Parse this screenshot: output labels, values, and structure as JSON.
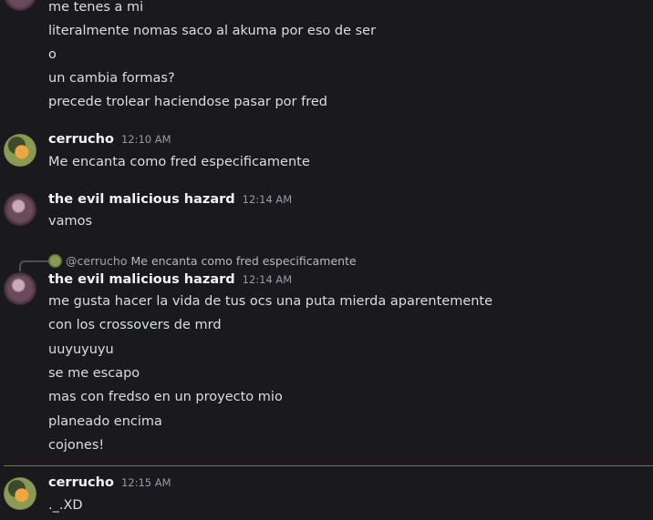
{
  "top_group": {
    "lines": [
      "me tenes a mi",
      "literalmente nomas saco al akuma por eso de ser",
      "o",
      "un cambia formas?",
      "precede trolear haciendose pasar por fred"
    ]
  },
  "messages": [
    {
      "username": "cerrucho",
      "timestamp": "12:10 AM",
      "lines": [
        "Me encanta como fred especificamente"
      ]
    },
    {
      "username": "the evil malicious hazard",
      "timestamp": "12:14 AM",
      "lines": [
        "vamos"
      ]
    },
    {
      "reply": {
        "username": "@cerrucho",
        "text": "Me encanta como fred especificamente"
      },
      "username": "the evil malicious hazard",
      "timestamp": "12:14 AM",
      "lines": [
        "me gusta hacer la vida de tus ocs una puta mierda aparentemente",
        "con los crossovers de mrd",
        "uuyuyuyu",
        "se me escapo",
        "mas con fredso en un proyecto mio",
        "planeado  encima",
        "cojones!"
      ]
    },
    {
      "username": "cerrucho",
      "timestamp": "12:15 AM",
      "lines": [
        "._.XD"
      ]
    }
  ],
  "colors": {
    "background": "#1a1a1e",
    "text": "#dbdee1",
    "timestamp": "#949ba4",
    "new_messages_divider": "#e43d3d"
  }
}
